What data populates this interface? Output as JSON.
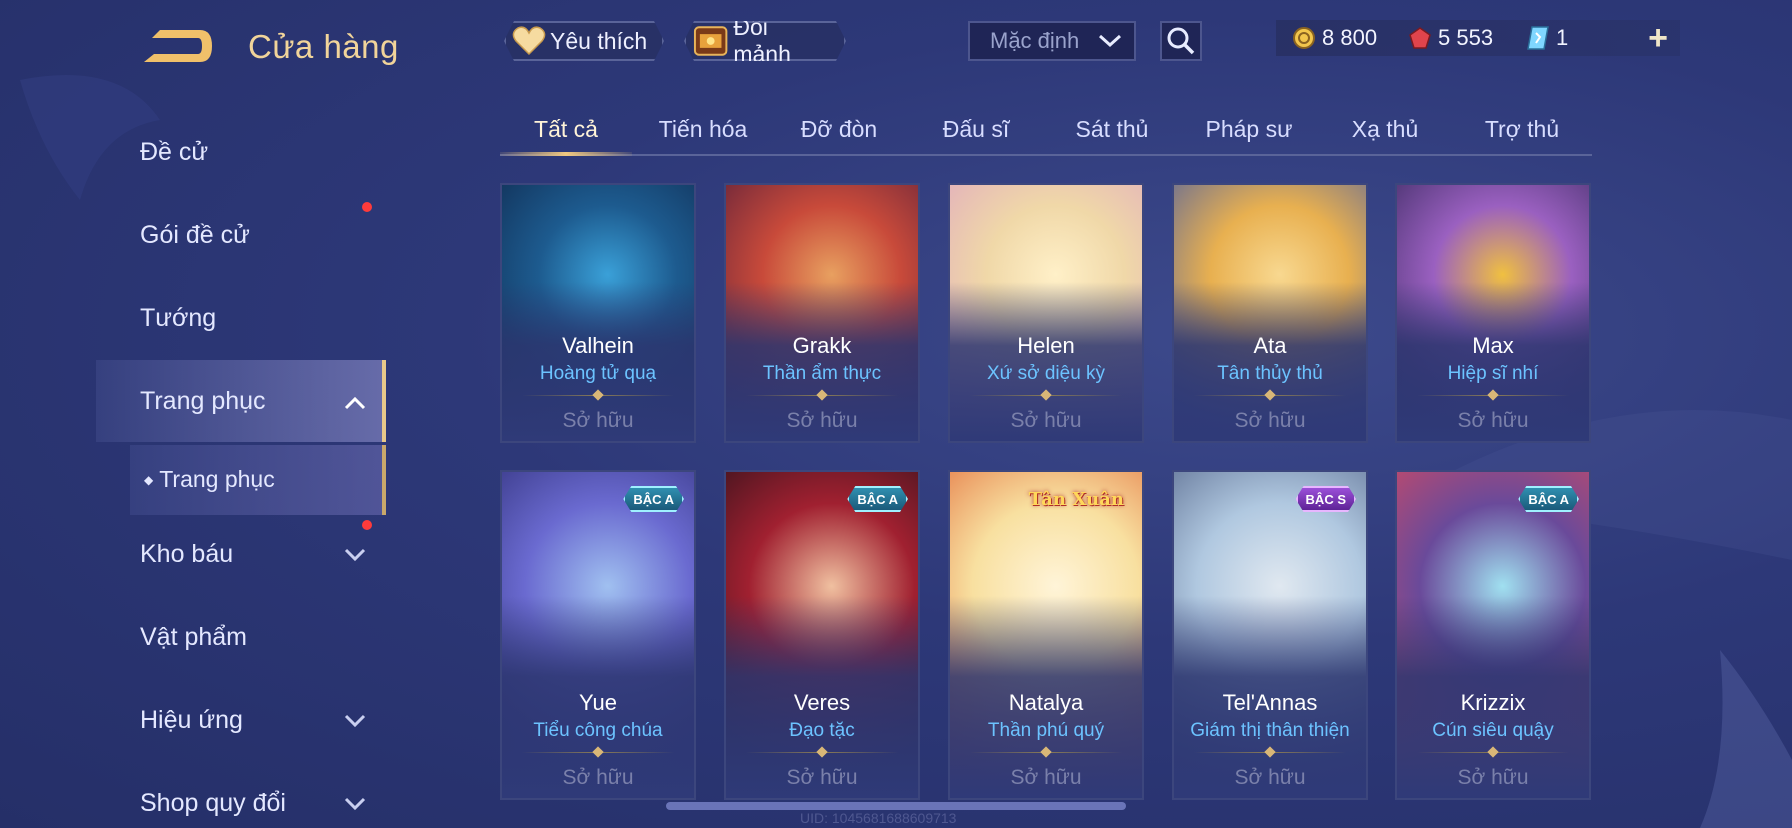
{
  "header": {
    "title": "Cửa hàng",
    "favorites_label": "Yêu thích",
    "exchange_label": "Đổi mảnh",
    "sort_select_value": "Mặc định"
  },
  "currency": {
    "gold": "8 800",
    "ruby": "5 553",
    "voucher": "1"
  },
  "sidebar": {
    "items": [
      {
        "label": "Đề cử"
      },
      {
        "label": "Gói đề cử"
      },
      {
        "label": "Tướng"
      },
      {
        "label": "Trang phục"
      },
      {
        "label": "Kho báu"
      },
      {
        "label": "Vật phẩm"
      },
      {
        "label": "Hiệu ứng"
      },
      {
        "label": "Shop quy đổi"
      }
    ],
    "sub_item": "Trang phục"
  },
  "tabs": [
    {
      "label": "Tất cả"
    },
    {
      "label": "Tiến hóa"
    },
    {
      "label": "Đỡ đòn"
    },
    {
      "label": "Đấu sĩ"
    },
    {
      "label": "Sát thủ"
    },
    {
      "label": "Pháp sư"
    },
    {
      "label": "Xạ thủ"
    },
    {
      "label": "Trợ thủ"
    }
  ],
  "skins": [
    {
      "hero": "Valhein",
      "skin": "Hoàng tử quạ",
      "status": "Sở hữu",
      "badge": ""
    },
    {
      "hero": "Grakk",
      "skin": "Thần ẩm thực",
      "status": "Sở hữu",
      "badge": ""
    },
    {
      "hero": "Helen",
      "skin": "Xứ sở diệu kỳ",
      "status": "Sở hữu",
      "badge": ""
    },
    {
      "hero": "Ata",
      "skin": "Tân thủy thủ",
      "status": "Sở hữu",
      "badge": ""
    },
    {
      "hero": "Max",
      "skin": "Hiệp sĩ nhí",
      "status": "Sở hữu",
      "badge": ""
    },
    {
      "hero": "Yue",
      "skin": "Tiểu công chúa",
      "status": "Sở hữu",
      "badge": "BẬC A"
    },
    {
      "hero": "Veres",
      "skin": "Đạo tặc",
      "status": "Sở hữu",
      "badge": "BẬC A"
    },
    {
      "hero": "Natalya",
      "skin": "Thần phú quý",
      "status": "Sở hữu",
      "badge": "Tân Xuân"
    },
    {
      "hero": "Tel'Annas",
      "skin": "Giám thị thân thiện",
      "status": "Sở hữu",
      "badge": "BẬC S"
    },
    {
      "hero": "Krizzix",
      "skin": "Cún siêu quậy",
      "status": "Sở hữu",
      "badge": "BẬC A"
    }
  ],
  "footer": {
    "uid": "UID: 1045681688609713"
  },
  "colors": {
    "accent_gold": "#f1d49a",
    "skin_name_blue": "#6cc3ff",
    "badge_a": "#2f8fb0",
    "badge_s": "#9b4fd8",
    "notification_red": "#ff3b3b"
  }
}
